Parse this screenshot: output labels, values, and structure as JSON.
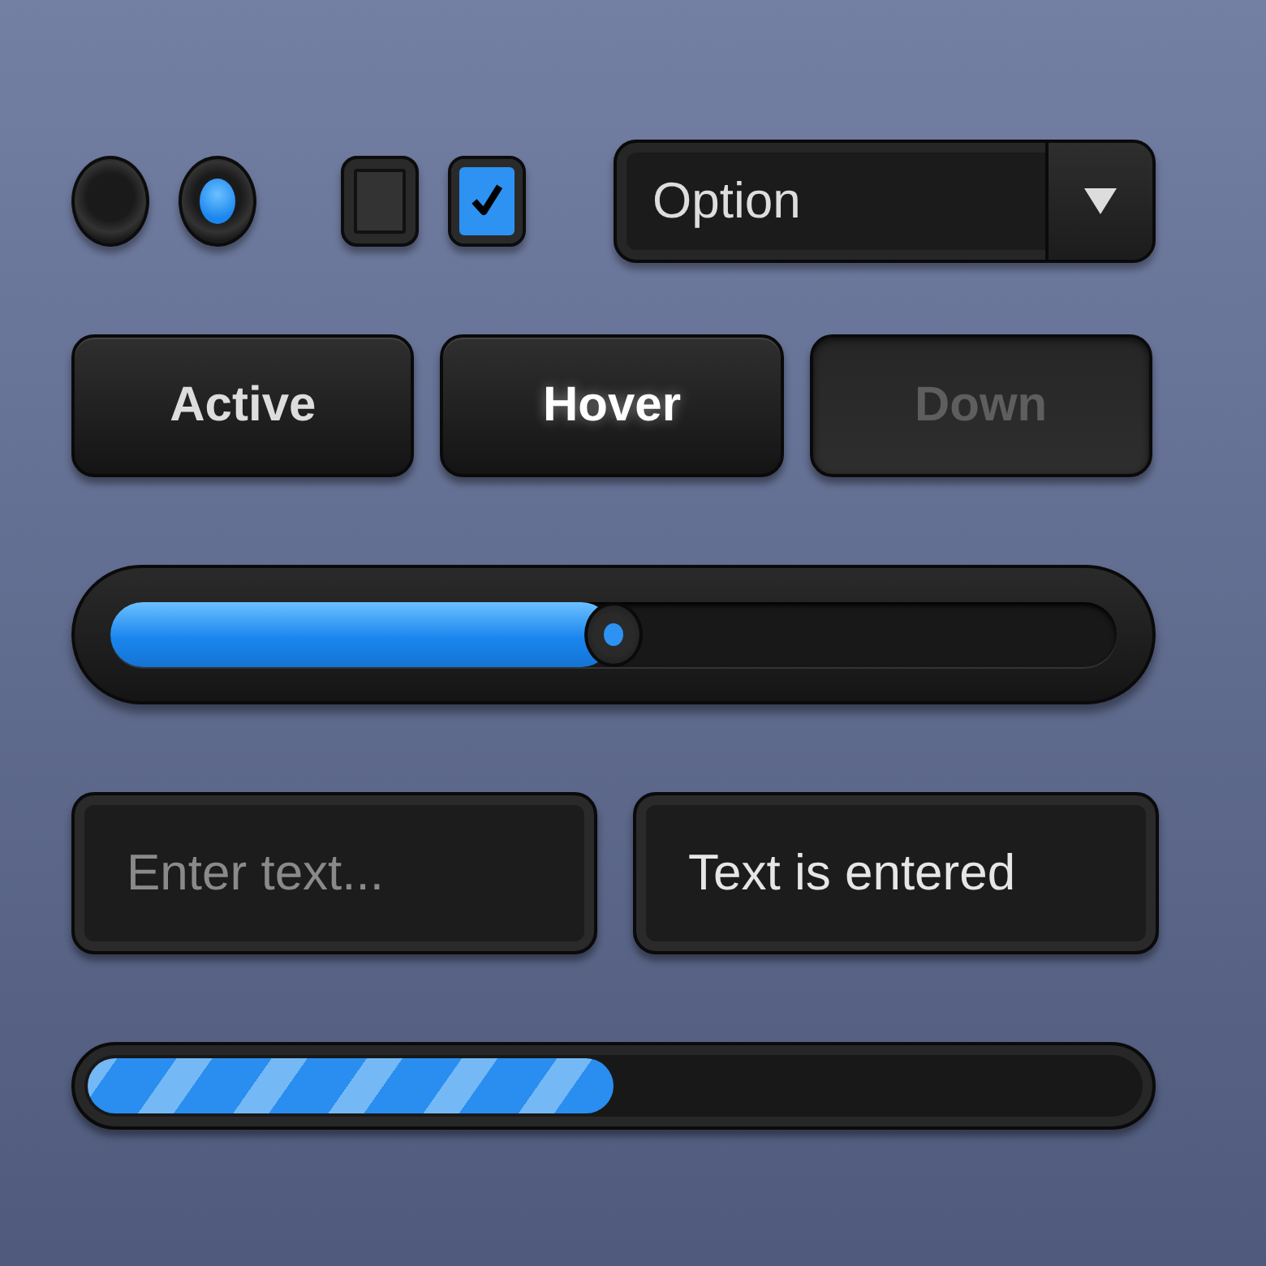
{
  "radios": [
    {
      "selected": false
    },
    {
      "selected": true
    }
  ],
  "checkboxes": [
    {
      "checked": false
    },
    {
      "checked": true
    }
  ],
  "dropdown": {
    "value": "Option"
  },
  "buttons": [
    {
      "label": "Active",
      "kind": "active"
    },
    {
      "label": "Hover",
      "kind": "hover"
    },
    {
      "label": "Down",
      "kind": "down"
    }
  ],
  "slider": {
    "level": 0.5
  },
  "fields": [
    {
      "placeholder": "Enter text..."
    },
    {
      "value": "Text is entered"
    }
  ],
  "progress": {
    "level": 0.5
  }
}
